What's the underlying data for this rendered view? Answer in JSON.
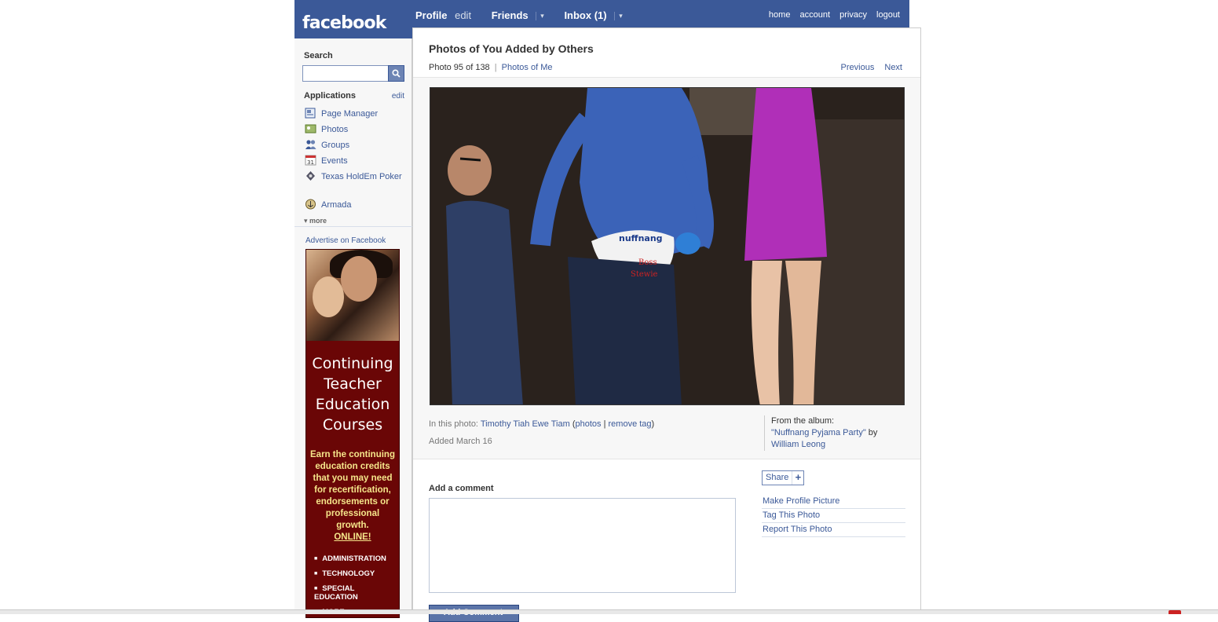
{
  "brand": {
    "logo": "facebook"
  },
  "topnav": {
    "profile": "Profile",
    "profile_edit": "edit",
    "friends": "Friends",
    "inbox": "Inbox (1)",
    "caret": "▾"
  },
  "toplinks": [
    "home",
    "account",
    "privacy",
    "logout"
  ],
  "sidebar": {
    "search_label": "Search",
    "search_value": "",
    "search_icon": "search-icon",
    "apps_title": "Applications",
    "apps_edit": "edit",
    "apps": [
      {
        "label": "Page Manager",
        "icon": "page-manager-icon"
      },
      {
        "label": "Photos",
        "icon": "photos-icon"
      },
      {
        "label": "Groups",
        "icon": "groups-icon"
      },
      {
        "label": "Events",
        "icon": "calendar-icon"
      },
      {
        "label": "Texas HoldEm Poker",
        "icon": "poker-icon"
      },
      {
        "label": "Armada",
        "icon": "armada-icon"
      }
    ],
    "more": "▾ more",
    "advertise": "Advertise on Facebook"
  },
  "ad": {
    "title": "Continuing Teacher Education Courses",
    "body": "Earn the continuing education credits that you may need for recertification, endorsements or professional growth.",
    "online": "ONLINE!",
    "list": [
      "ADMINISTRATION",
      "TECHNOLOGY",
      "SPECIAL EDUCATION",
      "MORE"
    ]
  },
  "photo_page": {
    "title": "Photos of You Added by Others",
    "counter": "Photo 95 of 138",
    "separator": "|",
    "photos_of_me": "Photos of Me",
    "previous": "Previous",
    "next": "Next",
    "in_photo_label": "In this photo:",
    "tagged_person": "Timothy Tiah Ewe Tiam",
    "paren_open": "(",
    "photos_link": "photos",
    "pipe": "|",
    "remove_tag": "remove tag",
    "paren_close": ")",
    "added": "Added March 16",
    "album_label": "From the album:",
    "album_name": "\"Nuffnang Pyjama Party\"",
    "by": "by",
    "album_owner": "William Leong",
    "photo_text": {
      "brand": "nuffnang",
      "line1": "Boss",
      "line2": "Stewie"
    }
  },
  "comment": {
    "label": "Add a comment",
    "value": "",
    "button": "Add Comment"
  },
  "share": {
    "label": "Share",
    "plus": "+"
  },
  "actions": [
    "Make Profile Picture",
    "Tag This Photo",
    "Report This Photo"
  ],
  "colors": {
    "brand_blue": "#3b5998",
    "link": "#3b5998",
    "sidebar_bg": "#f7f7f7",
    "ad_bg": "#6a0606",
    "ad_text": "#f5e58a"
  }
}
